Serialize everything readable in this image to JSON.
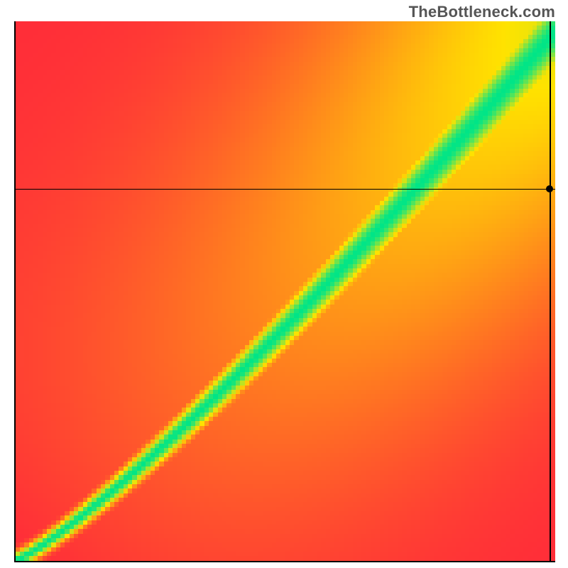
{
  "watermark": "TheBottleneck.com",
  "chart_data": {
    "type": "heatmap",
    "title": "",
    "xlabel": "",
    "ylabel": "",
    "xlim": [
      0,
      100
    ],
    "ylim": [
      0,
      100
    ],
    "color_scale": {
      "description": "bottleneck compatibility score",
      "low": "#ff2a3a",
      "mid": "#ffe300",
      "high": "#00e688",
      "0": "worst (red)",
      "50": "marginal (yellow)",
      "100": "ideal (green)"
    },
    "ridge": {
      "description": "ideal-match diagonal; green band widens toward high x/y",
      "base_halfwidth_pct": 2.0,
      "max_halfwidth_pct": 9.0
    },
    "crosshair": {
      "x_pct": 99.0,
      "y_pct": 69.0
    },
    "marker": {
      "x_pct": 99.0,
      "y_pct": 69.0
    },
    "grid_resolution": 120
  }
}
